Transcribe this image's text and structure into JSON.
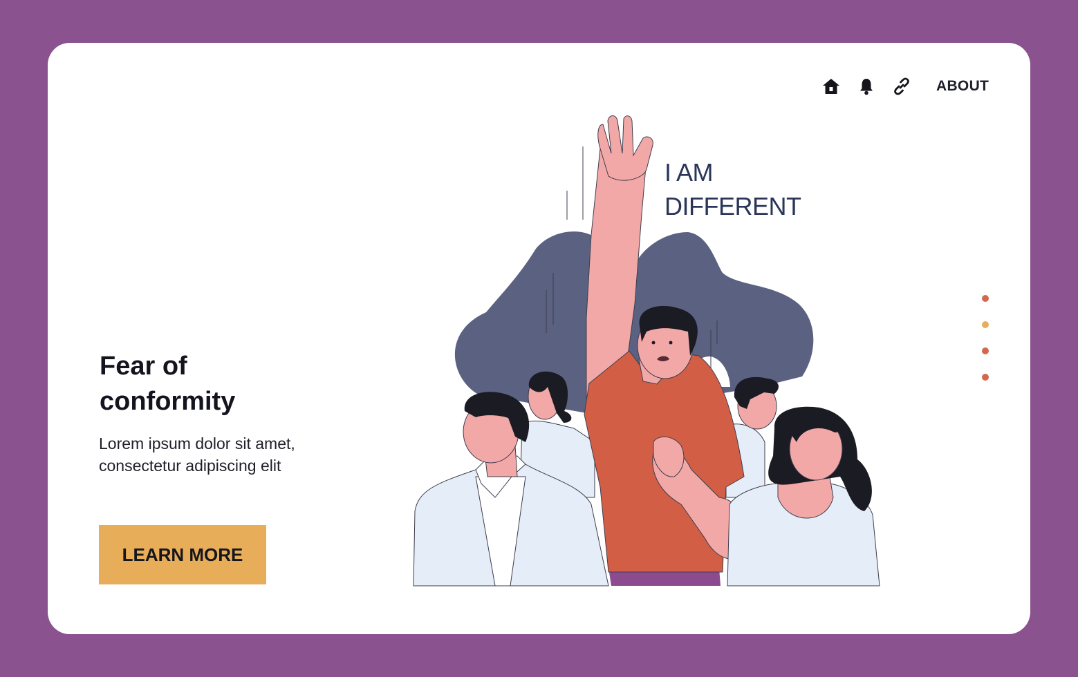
{
  "nav": {
    "icons": [
      "home-icon",
      "bell-icon",
      "link-icon"
    ],
    "about_label": "ABOUT"
  },
  "hero": {
    "title": "Fear of conformity",
    "body": "Lorem ipsum dolor sit amet, consectetur adipiscing elit",
    "cta_label": "LEARN MORE"
  },
  "illustration": {
    "slogan_line1": "I AM",
    "slogan_line2": "DIFFERENT"
  },
  "pagination": {
    "dots": 4,
    "active_index": 1
  },
  "colors": {
    "frame": "#8a528e",
    "card": "#ffffff",
    "cta": "#e8ad58",
    "shirt": "#d25f45",
    "skin": "#f3a8a8",
    "blob": "#5b6180",
    "dot": "#d2684f",
    "dot_active": "#e8ad58"
  }
}
